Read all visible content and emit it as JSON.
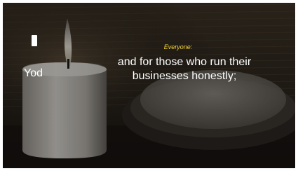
{
  "slide": {
    "hebrew_letter_glyph": "",
    "letter_name": "Yod",
    "speaker": "Everyone:",
    "lines": [
      "and for those who run their",
      "businesses honestly;"
    ]
  },
  "colors": {
    "speaker_label": "#f2d23a",
    "body_text": "#ffffff",
    "background": "#1c1814"
  }
}
